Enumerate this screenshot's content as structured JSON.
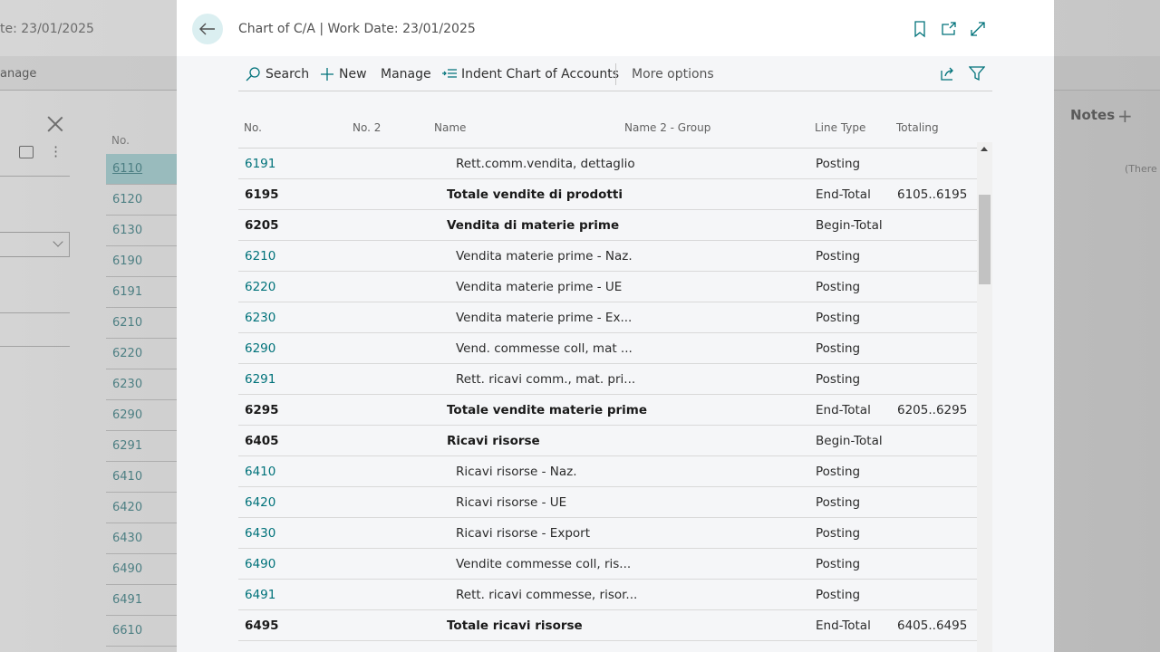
{
  "background": {
    "title_fragment": "te: 23/01/2025",
    "manage_fragment": "anage",
    "list_header": "No.",
    "list_items": [
      "6110",
      "6120",
      "6130",
      "6190",
      "6191",
      "6210",
      "6220",
      "6230",
      "6290",
      "6291",
      "6410",
      "6420",
      "6430",
      "6490",
      "6491",
      "6610"
    ],
    "selected_item": "6110",
    "notes_title": "Notes",
    "notes_add": "+",
    "notes_empty": "(There i"
  },
  "dialog": {
    "title": "Chart of C/A | Work Date: 23/01/2025",
    "header_icons": [
      "bookmark-icon",
      "open-new-window-icon",
      "expand-icon"
    ],
    "toolbar": {
      "search": "Search",
      "new": "New",
      "manage": "Manage",
      "indent": "Indent Chart of Accounts",
      "more": "More options"
    },
    "columns": {
      "no": "No.",
      "no2": "No. 2",
      "name": "Name",
      "name2": "Name 2 - Group",
      "line_type": "Line Type",
      "totaling": "Totaling"
    },
    "rows": [
      {
        "no": "6191",
        "name": "Rett.comm.vendita, dettaglio",
        "line_type": "Posting",
        "totaling": "",
        "bold": false
      },
      {
        "no": "6195",
        "name": "Totale vendite di prodotti",
        "line_type": "End-Total",
        "totaling": "6105..6195",
        "bold": true
      },
      {
        "no": "6205",
        "name": "Vendita di materie prime",
        "line_type": "Begin-Total",
        "totaling": "",
        "bold": true
      },
      {
        "no": "6210",
        "name": "Vendita materie prime - Naz.",
        "line_type": "Posting",
        "totaling": "",
        "bold": false
      },
      {
        "no": "6220",
        "name": "Vendita materie prime - UE",
        "line_type": "Posting",
        "totaling": "",
        "bold": false
      },
      {
        "no": "6230",
        "name": "Vendita materie prime - Ex...",
        "line_type": "Posting",
        "totaling": "",
        "bold": false
      },
      {
        "no": "6290",
        "name": "Vend. commesse coll, mat ...",
        "line_type": "Posting",
        "totaling": "",
        "bold": false
      },
      {
        "no": "6291",
        "name": "Rett. ricavi comm., mat. pri...",
        "line_type": "Posting",
        "totaling": "",
        "bold": false
      },
      {
        "no": "6295",
        "name": "Totale vendite materie prime",
        "line_type": "End-Total",
        "totaling": "6205..6295",
        "bold": true
      },
      {
        "no": "6405",
        "name": "Ricavi risorse",
        "line_type": "Begin-Total",
        "totaling": "",
        "bold": true
      },
      {
        "no": "6410",
        "name": "Ricavi risorse - Naz.",
        "line_type": "Posting",
        "totaling": "",
        "bold": false
      },
      {
        "no": "6420",
        "name": "Ricavi risorse - UE",
        "line_type": "Posting",
        "totaling": "",
        "bold": false
      },
      {
        "no": "6430",
        "name": "Ricavi risorse - Export",
        "line_type": "Posting",
        "totaling": "",
        "bold": false
      },
      {
        "no": "6490",
        "name": "Vendite commesse coll, ris...",
        "line_type": "Posting",
        "totaling": "",
        "bold": false
      },
      {
        "no": "6491",
        "name": "Rett. ricavi commesse, risor...",
        "line_type": "Posting",
        "totaling": "",
        "bold": false
      },
      {
        "no": "6495",
        "name": "Totale ricavi risorse",
        "line_type": "End-Total",
        "totaling": "6405..6495",
        "bold": true
      }
    ]
  },
  "colors": {
    "accent": "#00727a",
    "back_button_bg": "#dbeff1",
    "dialog_bg": "#f5f6f8"
  }
}
